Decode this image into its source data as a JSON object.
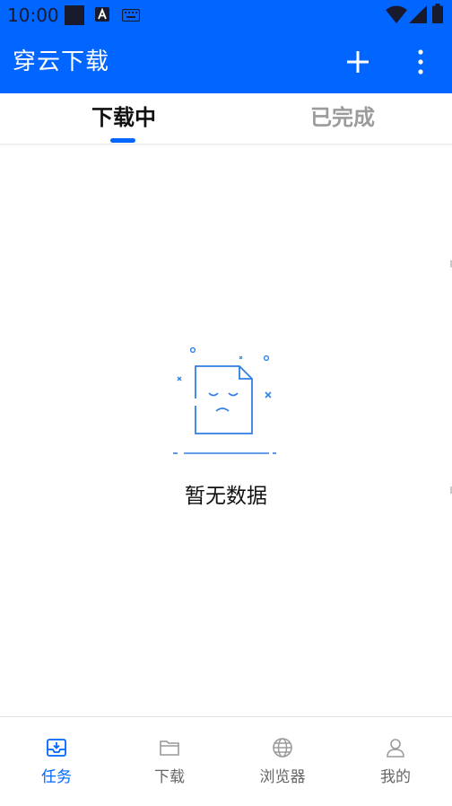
{
  "status_bar": {
    "time": "10:00",
    "icons": [
      "square-icon",
      "a-icon",
      "keyboard-icon",
      "wifi-icon",
      "signal-icon",
      "battery-icon"
    ]
  },
  "app_bar": {
    "title": "穿云下载",
    "background_color": "#0066ff",
    "actions": [
      "add-icon",
      "more-vert-icon"
    ]
  },
  "tabs": {
    "items": [
      {
        "label": "下载中",
        "active": true
      },
      {
        "label": "已完成",
        "active": false
      }
    ],
    "indicator_color": "#0066ff"
  },
  "empty_state": {
    "icon": "empty-document-icon",
    "text": "暂无数据"
  },
  "bottom_nav": {
    "items": [
      {
        "label": "任务",
        "icon": "task-download-icon",
        "active": true
      },
      {
        "label": "下载",
        "icon": "folder-icon",
        "active": false
      },
      {
        "label": "浏览器",
        "icon": "globe-icon",
        "active": false
      },
      {
        "label": "我的",
        "icon": "profile-icon",
        "active": false
      }
    ],
    "active_color": "#0066ff",
    "inactive_color": "#666666"
  }
}
